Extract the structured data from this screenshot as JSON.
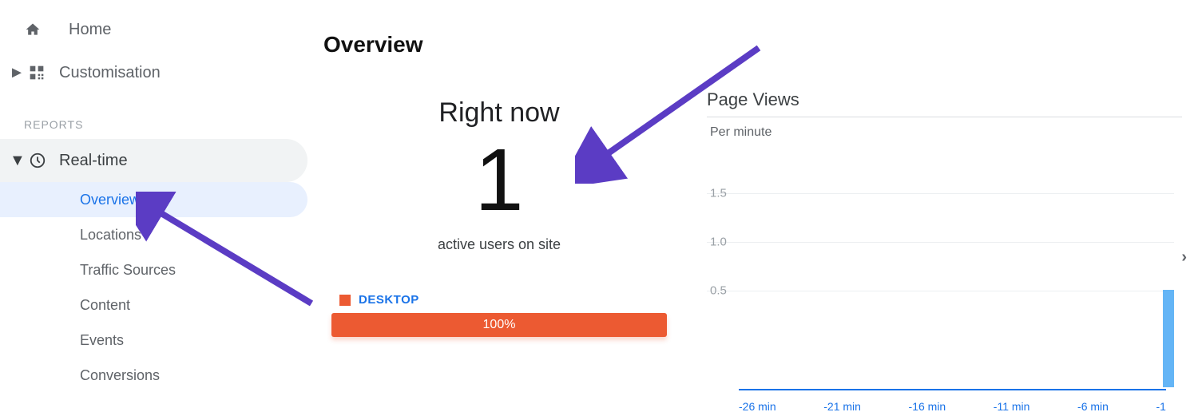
{
  "sidebar": {
    "home": "Home",
    "customisation": "Customisation",
    "reports_label": "REPORTS",
    "realtime": "Real-time",
    "items": [
      "Overview",
      "Locations",
      "Traffic Sources",
      "Content",
      "Events",
      "Conversions"
    ],
    "active_index": 0
  },
  "main": {
    "title": "Overview",
    "right_now": "Right now",
    "count": "1",
    "active_users_label": "active users on site",
    "device": {
      "label": "DESKTOP",
      "percent": "100%",
      "color": "#ec5a32"
    }
  },
  "chart_data": {
    "type": "bar",
    "title": "Page Views",
    "subtitle": "Per minute",
    "ylabel": "",
    "ylim": [
      0,
      2
    ],
    "yticks": [
      0.5,
      1.0,
      1.5
    ],
    "categories": [
      "-26 min",
      "-21 min",
      "-16 min",
      "-11 min",
      "-6 min",
      "-1"
    ],
    "values": [
      0,
      0,
      0,
      0,
      0,
      1
    ]
  }
}
